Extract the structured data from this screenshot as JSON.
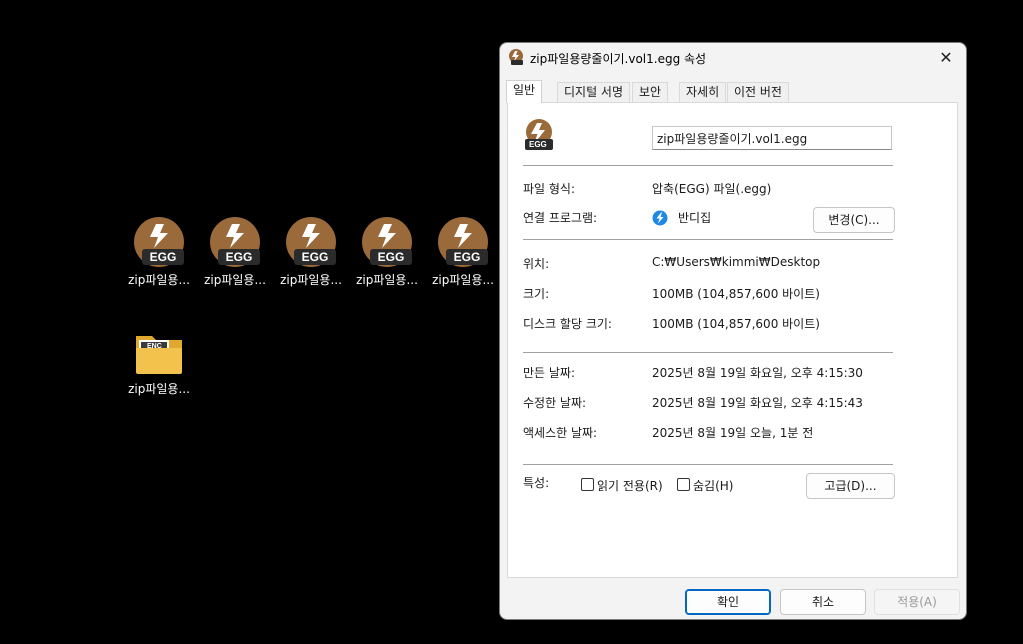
{
  "desktop": {
    "egg_icons": [
      {
        "label": "zip파일용...",
        "badge": "EGG"
      },
      {
        "label": "zip파일용...",
        "badge": "EGG"
      },
      {
        "label": "zip파일용...",
        "badge": "EGG"
      },
      {
        "label": "zip파일용...",
        "badge": "EGG"
      },
      {
        "label": "zip파일용...",
        "badge": "EGG"
      }
    ],
    "folder_icon": {
      "label": "zip파일용...",
      "badge": "ENC"
    }
  },
  "dialog": {
    "title": "zip파일용량줄이기.vol1.egg 속성",
    "close_glyph": "✕",
    "tabs": [
      "일반",
      "디지털 서명",
      "보안",
      "자세히",
      "이전 버전"
    ],
    "active_tab": "일반",
    "file_icon_badge": "EGG",
    "filename": "zip파일용량줄이기.vol1.egg",
    "file_type_label": "파일 형식:",
    "file_type_value": "압축(EGG) 파일(.egg)",
    "open_with_label": "연결 프로그램:",
    "open_with_value": "반디집",
    "change_button": "변경(C)...",
    "location_label": "위치:",
    "location_value": "C:₩Users₩kimmi₩Desktop",
    "size_label": "크기:",
    "size_value": "100MB (104,857,600 바이트)",
    "disk_size_label": "디스크 할당 크기:",
    "disk_size_value": "100MB (104,857,600 바이트)",
    "created_label": "만든 날짜:",
    "created_value": "2025년 8월 19일 화요일, 오후 4:15:30",
    "modified_label": "수정한 날짜:",
    "modified_value": "2025년 8월 19일 화요일, 오후 4:15:43",
    "accessed_label": "액세스한 날짜:",
    "accessed_value": "2025년 8월 19일 오늘, 1분 전",
    "attributes_label": "특성:",
    "readonly_label": "읽기 전용(R)",
    "readonly_checked": false,
    "hidden_label": "숨김(H)",
    "hidden_checked": false,
    "advanced_button": "고급(D)...",
    "ok_button": "확인",
    "cancel_button": "취소",
    "apply_button": "적용(A)"
  },
  "colors": {
    "egg_brown": "#9a6a3a",
    "badge_dark": "#2b2b2b",
    "folder_yellow": "#f2c24c",
    "primary_blue": "#0067c0",
    "bandizip_blue": "#1e88e5"
  }
}
